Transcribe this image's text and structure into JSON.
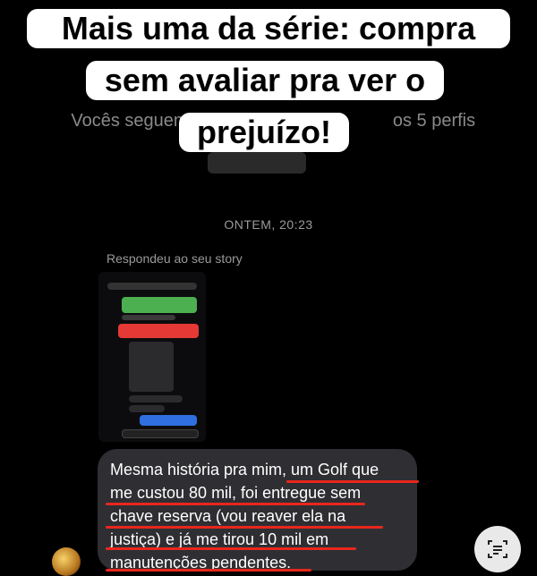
{
  "caption": {
    "lines": [
      "Mais uma da série: compra",
      "sem avaliar pra ver o",
      "prejuízo!"
    ]
  },
  "background_text": {
    "line_left": "Vocês seguem",
    "line_right": "os 5 perfis"
  },
  "thread": {
    "timestamp": "ONTEM, 20:23",
    "replied_label": "Respondeu ao seu story",
    "message_lines": [
      "Mesma história pra mim, um Golf que",
      "me custou 80 mil, foi entregue sem",
      "chave reserva (vou reaver ela na",
      "justiça) e já me tirou 10 mil em",
      "manutenções pendentes."
    ]
  },
  "colors": {
    "caption_bg": "#ffffff",
    "bubble_bg": "#2f2f33",
    "underline": "#e8271c",
    "story_green": "#4caf50",
    "story_red": "#e53935",
    "story_blue": "#2f6fe0"
  },
  "icons": {
    "avatar": "golden-ball-avatar",
    "scan": "scan-text-icon"
  }
}
